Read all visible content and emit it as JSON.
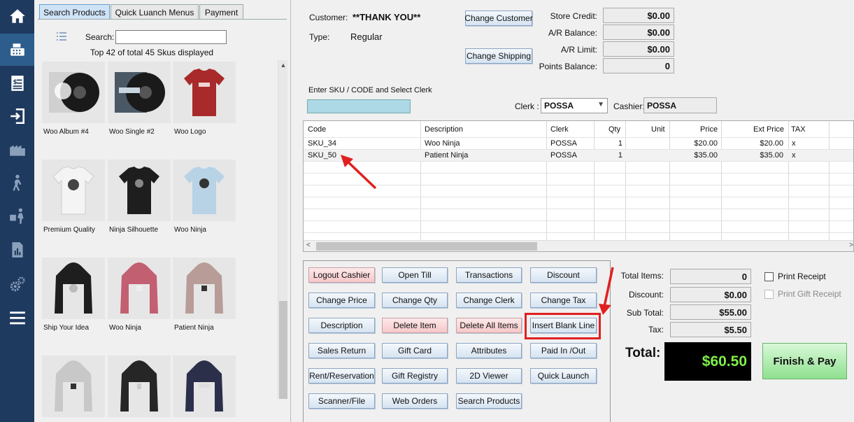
{
  "colors": {
    "nav_bg": "#1f3a5f",
    "accent_blue": "#add8e6",
    "total_green": "#7cf04a",
    "annotation_red": "#e02020"
  },
  "nav": {
    "items": [
      {
        "name": "home-icon"
      },
      {
        "name": "cash-register-icon"
      },
      {
        "name": "invoice-icon"
      },
      {
        "name": "sign-in-icon"
      },
      {
        "name": "warehouse-icon"
      },
      {
        "name": "customer-walking-icon"
      },
      {
        "name": "delivery-person-icon"
      },
      {
        "name": "report-icon"
      },
      {
        "name": "settings-gears-icon"
      },
      {
        "name": "menu-hamburger-icon"
      }
    ]
  },
  "tabs": [
    "Search Products",
    "Quick Luanch Menus",
    "Payment"
  ],
  "search": {
    "label": "Search:",
    "value": "",
    "sku_count": "Top 42 of total 45 Skus displayed"
  },
  "products": [
    {
      "name": "Woo Album #4",
      "icon": "vinyl-album-icon"
    },
    {
      "name": "Woo Single #2",
      "icon": "vinyl-single-icon"
    },
    {
      "name": "Woo Logo",
      "icon": "red-tshirt-icon"
    },
    {
      "name": "Premium Quality",
      "icon": "white-tshirt-icon"
    },
    {
      "name": "Ninja Silhouette",
      "icon": "black-tshirt-icon"
    },
    {
      "name": "Woo Ninja",
      "icon": "blue-tshirt-icon"
    },
    {
      "name": "Ship Your Idea",
      "icon": "black-hoodie-icon"
    },
    {
      "name": "Woo Ninja",
      "icon": "pink-hoodie-icon"
    },
    {
      "name": "Patient Ninja",
      "icon": "tan-hoodie-icon"
    },
    {
      "name": "",
      "icon": "grey-hoodie-icon"
    },
    {
      "name": "",
      "icon": "black-hoodie-icon"
    },
    {
      "name": "",
      "icon": "navy-hoodie-icon"
    }
  ],
  "customer": {
    "customer_label": "Customer:",
    "customer_value": "**THANK YOU**",
    "type_label": "Type:",
    "type_value": "Regular",
    "change_customer": "Change Customer",
    "change_shipping": "Change Shipping"
  },
  "balances": {
    "store_credit_label": "Store Credit:",
    "store_credit": "$0.00",
    "ar_balance_label": "A/R Balance:",
    "ar_balance": "$0.00",
    "ar_limit_label": "A/R Limit:",
    "ar_limit": "$0.00",
    "points_label": "Points Balance:",
    "points": "0"
  },
  "entry": {
    "sku_label": "Enter SKU / CODE and Select Clerk",
    "clerk_label": "Clerk :",
    "clerk_value": "POSSA",
    "cashier_label": "Cashier:",
    "cashier_value": "POSSA"
  },
  "grid": {
    "headers": [
      "Code",
      "Description",
      "Clerk",
      "Qty",
      "Unit",
      "Price",
      "Ext Price",
      "TAX"
    ],
    "rows": [
      {
        "code": "SKU_34",
        "description": "Woo Ninja",
        "clerk": "POSSA",
        "qty": "1",
        "unit": "",
        "price": "$20.00",
        "ext_price": "$20.00",
        "tax": "x"
      },
      {
        "code": "SKU_50",
        "description": "Patient Ninja",
        "clerk": "POSSA",
        "qty": "1",
        "unit": "",
        "price": "$35.00",
        "ext_price": "$35.00",
        "tax": "x"
      }
    ]
  },
  "actions": {
    "logout_cashier": "Logout Cashier",
    "open_till": "Open Till",
    "transactions": "Transactions",
    "discount": "Discount",
    "change_price": "Change Price",
    "change_qty": "Change Qty",
    "change_clerk": "Change Clerk",
    "change_tax": "Change Tax",
    "description": "Description",
    "delete_item": "Delete Item",
    "delete_all_items": "Delete All Items",
    "insert_blank_line": "Insert Blank Line",
    "sales_return": "Sales Return",
    "gift_card": "Gift Card",
    "attributes": "Attributes",
    "paid_in_out": "Paid In /Out",
    "rent_reservation": "Rent/Reservation",
    "gift_registry": "Gift Registry",
    "viewer_2d": "2D Viewer",
    "quick_launch": "Quick Launch",
    "scanner_file": "Scanner/File",
    "web_orders": "Web Orders",
    "search_products": "Search Products"
  },
  "totals": {
    "total_items_label": "Total Items:",
    "total_items": "0",
    "discount_label": "Discount:",
    "discount": "$0.00",
    "subtotal_label": "Sub Total:",
    "subtotal": "$55.00",
    "tax_label": "Tax:",
    "tax": "$5.50",
    "total_label": "Total:",
    "total": "$60.50",
    "finish_pay": "Finish & Pay",
    "print_receipt": "Print Receipt",
    "print_gift_receipt": "Print Gift Receipt"
  }
}
